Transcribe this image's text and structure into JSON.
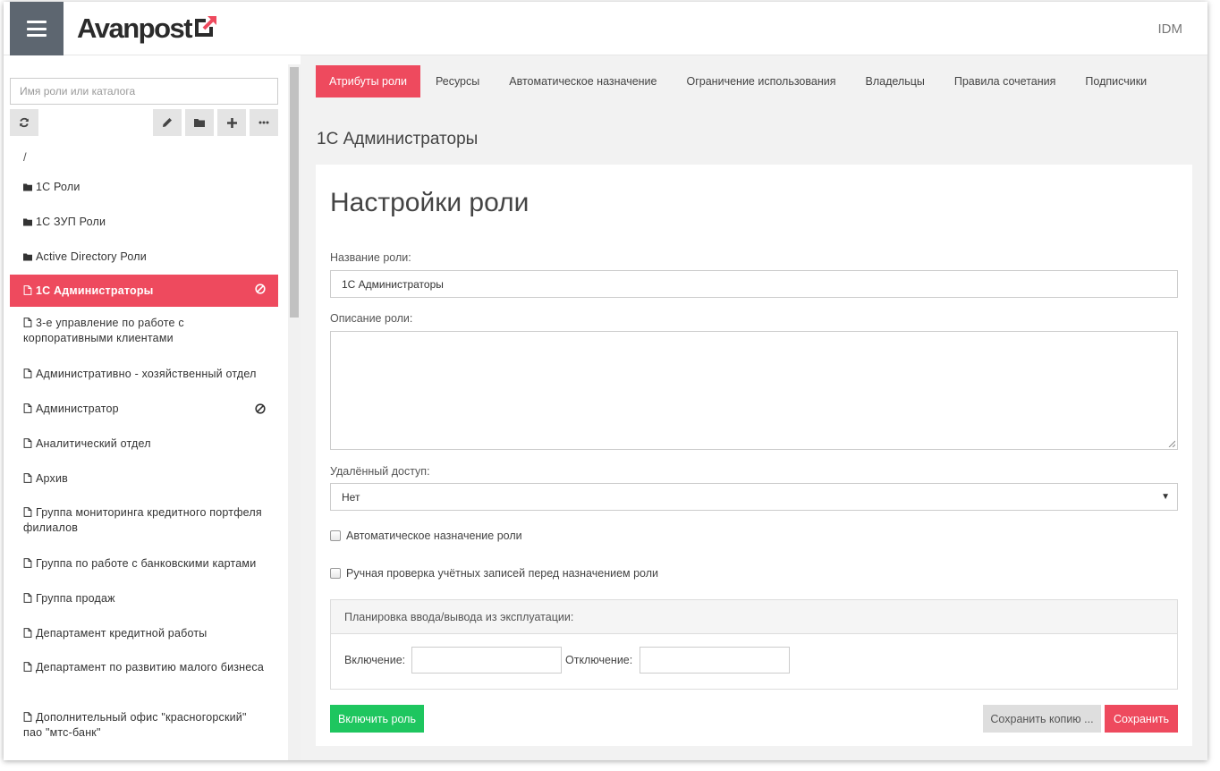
{
  "header": {
    "logo_text": "Avanpost",
    "app_label": "IDM"
  },
  "sidebar": {
    "search_placeholder": "Имя роли или каталога",
    "root": "/",
    "items": [
      {
        "label": "1С Роли",
        "type": "folder"
      },
      {
        "label": "1С ЗУП Роли",
        "type": "folder"
      },
      {
        "label": "Active Directory Роли",
        "type": "folder"
      },
      {
        "label": "1С Администраторы",
        "type": "file",
        "active": true,
        "disabled": true
      },
      {
        "label": "3-е управление по работе с корпоративными клиентами",
        "type": "file"
      },
      {
        "label": "Административно - хозяйственный отдел",
        "type": "file"
      },
      {
        "label": "Администратор",
        "type": "file",
        "disabled": true
      },
      {
        "label": "Аналитический отдел",
        "type": "file"
      },
      {
        "label": "Архив",
        "type": "file"
      },
      {
        "label": "Группа мониторинга кредитного портфеля филиалов",
        "type": "file"
      },
      {
        "label": "Группа по работе с банковскими картами",
        "type": "file"
      },
      {
        "label": "Группа продаж",
        "type": "file"
      },
      {
        "label": "Департамент кредитной работы",
        "type": "file"
      },
      {
        "label": "Департамент по развитию малого бизнеса",
        "type": "file"
      },
      {
        "label": "Дополнительный офис \"красногорский\" пао \"мтс-банк\"",
        "type": "file"
      }
    ]
  },
  "tabs": [
    {
      "label": "Атрибуты роли",
      "active": true
    },
    {
      "label": "Ресурсы"
    },
    {
      "label": "Автоматическое назначение"
    },
    {
      "label": "Ограничение использования"
    },
    {
      "label": "Владельцы"
    },
    {
      "label": "Правила сочетания"
    },
    {
      "label": "Подписчики"
    }
  ],
  "main": {
    "role_name_heading": "1С Администраторы",
    "card_title": "Настройки роли",
    "name_label": "Название роли:",
    "name_value": "1С Администраторы",
    "description_label": "Описание роли:",
    "description_value": "",
    "remote_label": "Удалённый доступ:",
    "remote_value": "Нет",
    "auto_assign_label": "Автоматическое назначение роли",
    "manual_check_label": "Ручная проверка учётных записей перед назначением роли",
    "schedule_title": "Планировка ввода/вывода из эксплуатации:",
    "enable_label": "Включение:",
    "disable_label": "Отключение:",
    "enable_button": "Включить роль",
    "save_copy_button": "Сохранить копию ...",
    "save_button": "Сохранить"
  },
  "colors": {
    "accent": "#ee4a5e",
    "success": "#1ec65f",
    "header_dark": "#5d6670"
  }
}
